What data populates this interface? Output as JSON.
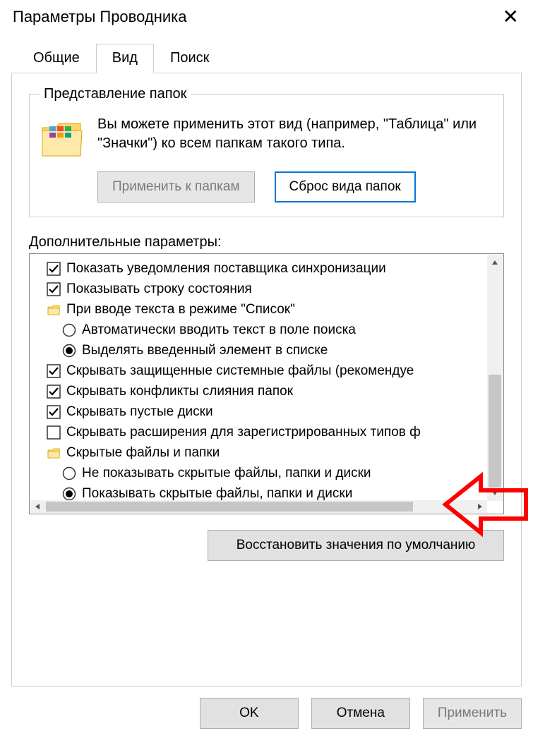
{
  "window": {
    "title": "Параметры Проводника"
  },
  "tabs": {
    "general": "Общие",
    "view": "Вид",
    "search": "Поиск"
  },
  "folderViews": {
    "legend": "Представление папок",
    "description": "Вы можете применить этот вид (например, \"Таблица\" или \"Значки\") ко всем папкам такого типа.",
    "applyButton": "Применить к папкам",
    "resetButton": "Сброс вида папок"
  },
  "advanced": {
    "label": "Дополнительные параметры:",
    "items": [
      {
        "kind": "check",
        "checked": true,
        "indent": 0,
        "label": "Показать уведомления поставщика синхронизации"
      },
      {
        "kind": "check",
        "checked": true,
        "indent": 0,
        "label": "Показывать строку состояния"
      },
      {
        "kind": "folder",
        "checked": false,
        "indent": 0,
        "label": "При вводе текста в режиме \"Список\""
      },
      {
        "kind": "radio",
        "checked": false,
        "indent": 1,
        "label": "Автоматически вводить текст в поле поиска"
      },
      {
        "kind": "radio",
        "checked": true,
        "indent": 1,
        "label": "Выделять введенный элемент в списке"
      },
      {
        "kind": "check",
        "checked": true,
        "indent": 0,
        "label": "Скрывать защищенные системные файлы (рекомендуе"
      },
      {
        "kind": "check",
        "checked": true,
        "indent": 0,
        "label": "Скрывать конфликты слияния папок"
      },
      {
        "kind": "check",
        "checked": true,
        "indent": 0,
        "label": "Скрывать пустые диски"
      },
      {
        "kind": "check",
        "checked": false,
        "indent": 0,
        "label": "Скрывать расширения для зарегистрированных типов ф"
      },
      {
        "kind": "folder",
        "checked": false,
        "indent": 0,
        "label": "Скрытые файлы и папки"
      },
      {
        "kind": "radio",
        "checked": false,
        "indent": 1,
        "label": "Не показывать скрытые файлы, папки и диски"
      },
      {
        "kind": "radio",
        "checked": true,
        "indent": 1,
        "label": "Показывать скрытые файлы, папки и диски"
      }
    ]
  },
  "restoreDefaults": "Восстановить значения по умолчанию",
  "buttons": {
    "ok": "OK",
    "cancel": "Отмена",
    "apply": "Применить"
  },
  "annotation": {
    "color": "#ff0000"
  }
}
